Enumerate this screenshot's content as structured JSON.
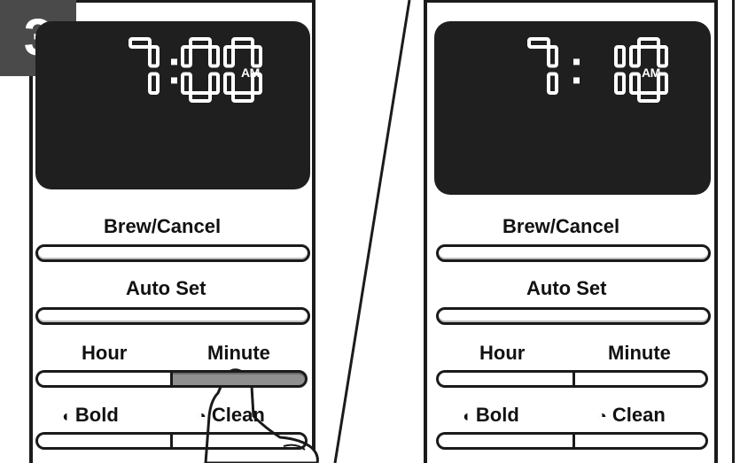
{
  "step_number": "3",
  "left_panel": {
    "display_time": "7:00",
    "display_ampm": "AM",
    "display_flashing": true,
    "brew_cancel_label": "Brew/Cancel",
    "auto_set_label": "Auto Set",
    "hour_label": "Hour",
    "minute_label": "Minute",
    "bold_label": "Bold",
    "clean_label": "Clean",
    "pressed_button": "Minute"
  },
  "right_panel": {
    "display_time": "7:10",
    "display_ampm": "AM",
    "brew_cancel_label": "Brew/Cancel",
    "auto_set_label": "Auto Set",
    "hour_label": "Hour",
    "minute_label": "Minute",
    "bold_label": "Bold",
    "clean_label": "Clean"
  },
  "icons": {
    "bold": "bold-bean-icon",
    "clean": "clean-clock-icon",
    "finger": "pointing-finger-icon"
  },
  "colors": {
    "lcd_background": "#1f1f1f",
    "lcd_digits": "#ffffff",
    "badge": "#4a4a4a",
    "pressed_button": "#8f8f8f"
  }
}
